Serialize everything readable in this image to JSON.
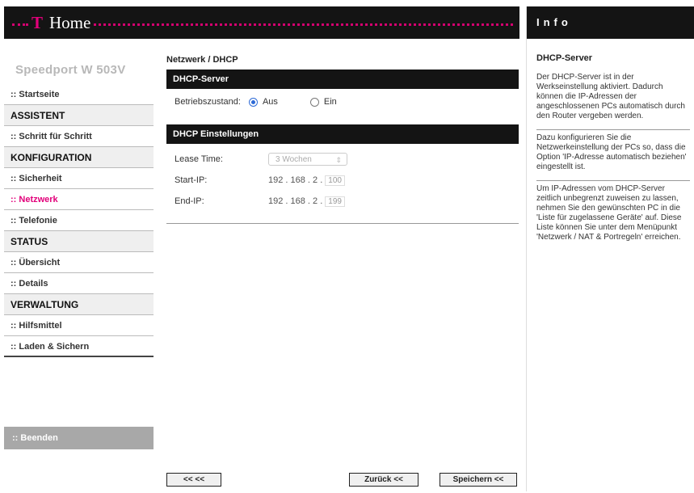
{
  "header": {
    "brand_t": "T",
    "brand": "Home"
  },
  "sidebar": {
    "device": "Speedport W 503V",
    "items": [
      {
        "label": ":: Startseite",
        "type": "item"
      },
      {
        "label": "ASSISTENT",
        "type": "section"
      },
      {
        "label": ":: Schritt für Schritt",
        "type": "item"
      },
      {
        "label": "KONFIGURATION",
        "type": "section"
      },
      {
        "label": ":: Sicherheit",
        "type": "item"
      },
      {
        "label": ":: Netzwerk",
        "type": "item",
        "active": true
      },
      {
        "label": ":: Telefonie",
        "type": "item"
      },
      {
        "label": "STATUS",
        "type": "section"
      },
      {
        "label": ":: Übersicht",
        "type": "item"
      },
      {
        "label": ":: Details",
        "type": "item"
      },
      {
        "label": "VERWALTUNG",
        "type": "section"
      },
      {
        "label": ":: Hilfsmittel",
        "type": "item"
      },
      {
        "label": ":: Laden & Sichern",
        "type": "item"
      }
    ],
    "logout": ":: Beenden"
  },
  "main": {
    "breadcrumb": "Netzwerk / DHCP",
    "dhcp_server": {
      "title": "DHCP-Server",
      "state_label": "Betriebszustand:",
      "option_off": "Aus",
      "option_on": "Ein",
      "selected": "Aus"
    },
    "settings": {
      "title": "DHCP Einstellungen",
      "lease_label": "Lease Time:",
      "lease_value": "3 Wochen",
      "start_label": "Start-IP:",
      "start_prefix": "192 . 168 . 2 .",
      "start_last": "100",
      "end_label": "End-IP:",
      "end_prefix": "192 . 168 . 2 .",
      "end_last": "199"
    },
    "buttons": {
      "back_start": "<< <<",
      "back": "Zurück <<",
      "save": "Speichern <<"
    }
  },
  "info": {
    "heading": "Info",
    "title": "DHCP-Server",
    "paragraphs": [
      "Der DHCP-Server ist in der Werkseinstellung aktiviert. Dadurch können die IP-Adressen der angeschlossenen PCs automatisch durch den Router vergeben werden.",
      "Dazu konfigurieren Sie die Netzwerkeinstellung der PCs so, dass die Option 'IP-Adresse automatisch beziehen' eingestellt ist.",
      "Um IP-Adressen vom DHCP-Server zeitlich unbegrenzt zuweisen zu lassen, nehmen Sie den gewünschten PC in die 'Liste für zugelassene Geräte' auf. Diese Liste können Sie unter dem Menüpunkt 'Netzwerk / NAT & Portregeln' erreichen."
    ]
  }
}
